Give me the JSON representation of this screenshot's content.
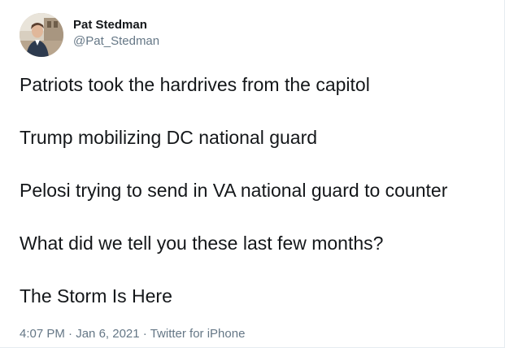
{
  "user": {
    "display_name": "Pat Stedman",
    "handle": "@Pat_Stedman"
  },
  "tweet": {
    "lines": [
      "Patriots took the hardrives from the capitol",
      "Trump mobilizing DC national guard",
      "Pelosi trying to send in VA national guard to counter",
      "What did we tell you these last few months?",
      "The Storm Is Here"
    ],
    "time": "4:07 PM",
    "date": "Jan 6, 2021",
    "source": "Twitter for iPhone",
    "separator": "·"
  },
  "colors": {
    "text": "#14171a",
    "secondary": "#657786",
    "background": "#ffffff"
  }
}
